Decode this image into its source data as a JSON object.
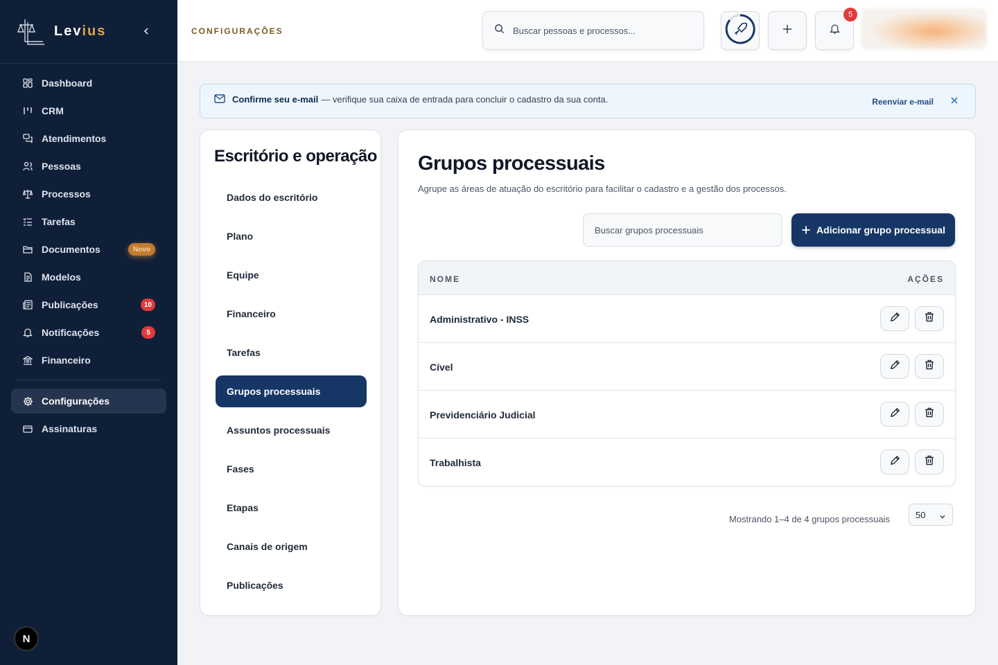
{
  "brand": {
    "name_a": "Lev",
    "name_b": "ius"
  },
  "sidebar": {
    "items": [
      {
        "label": "Dashboard",
        "icon": "dashboard-icon"
      },
      {
        "label": "CRM",
        "icon": "crm-icon"
      },
      {
        "label": "Atendimentos",
        "icon": "chat-icon"
      },
      {
        "label": "Pessoas",
        "icon": "users-icon"
      },
      {
        "label": "Processos",
        "icon": "scale-icon"
      },
      {
        "label": "Tarefas",
        "icon": "list-check-icon"
      },
      {
        "label": "Documentos",
        "icon": "folder-icon",
        "pill": "Novo"
      },
      {
        "label": "Modelos",
        "icon": "document-icon"
      },
      {
        "label": "Publicações",
        "icon": "newspaper-icon",
        "badge": "10"
      },
      {
        "label": "Notificações",
        "icon": "bell-icon",
        "badge": "5"
      },
      {
        "label": "Financeiro",
        "icon": "bank-icon"
      }
    ],
    "bottom_items": [
      {
        "label": "Configurações",
        "icon": "gear-icon",
        "active": true
      },
      {
        "label": "Assinaturas",
        "icon": "card-icon"
      }
    ],
    "footer_button": "N"
  },
  "topbar": {
    "breadcrumb": "CONFIGURAÇÕES",
    "search_placeholder": "Buscar pessoas e processos...",
    "notification_count": "5"
  },
  "banner": {
    "strong": "Confirme seu e-mail",
    "text": "— verifique sua caixa de entrada para concluir o cadastro da sua conta.",
    "resend": "Reenviar e-mail"
  },
  "settings_menu": {
    "title": "Escritório e operação",
    "items": [
      "Dados do escritório",
      "Plano",
      "Equipe",
      "Financeiro",
      "Tarefas",
      "Grupos processuais",
      "Assuntos processuais",
      "Fases",
      "Etapas",
      "Canais de origem",
      "Publicações"
    ],
    "active_index": 5
  },
  "main": {
    "title": "Grupos processuais",
    "subtitle": "Agrupe as áreas de atuação do escritório para facilitar o cadastro e a gestão dos processos.",
    "search_placeholder": "Buscar grupos processuais",
    "add_label": "Adicionar grupo processual",
    "table": {
      "col_name": "NOME",
      "col_actions": "AÇÕES",
      "rows": [
        "Administrativo - INSS",
        "Cível",
        "Previdenciário Judicial",
        "Trabalhista"
      ]
    },
    "pagination_text": "Mostrando 1–4 de 4 grupos processuais",
    "per_page": "50"
  },
  "colors": {
    "sidebar_bg": "#0f1f38",
    "primary": "#163765",
    "brand_accent": "#e3a24a",
    "badge_red": "#e03b3b"
  }
}
